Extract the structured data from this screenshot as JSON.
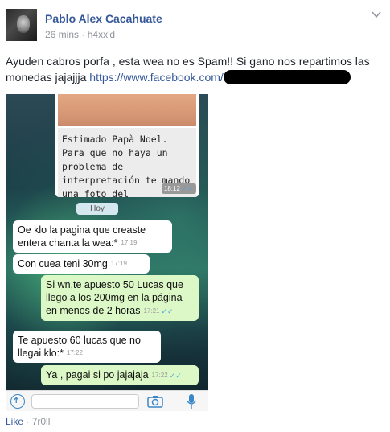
{
  "post": {
    "author": "Pablo Alex Cacahuate",
    "time": "26 mins",
    "location": "h4xx'd",
    "text": "Ayuden cabros porfa , esta wea no es Spam!! Si gano nos repartimos las monedas jajajjja",
    "link": "https://www.facebook.com/",
    "menu_icon": "chevron-down-icon"
  },
  "chat": {
    "photo_note": "Estimado Papà Noel. Para que no haya un problema de interpretación te mando una foto del",
    "photo_time": "18:12",
    "date_label": "Hoy",
    "messages": [
      {
        "dir": "in",
        "text": "Oe klo la pagina que creaste entera chanta la wea:*",
        "time": "17:19"
      },
      {
        "dir": "in",
        "text": "Con cuea teni 30mg",
        "time": "17:19"
      },
      {
        "dir": "out",
        "text": "Si wn,te apuesto 50 Lucas que llego a los 200mg en la página en menos de 2 horas",
        "time": "17:21"
      },
      {
        "dir": "in",
        "text": "Te apuesto 60 lucas que no llegai klo:*",
        "time": "17:22"
      },
      {
        "dir": "out",
        "text": "Ya , pagai si po jajajaja",
        "time": "17:22"
      }
    ]
  },
  "footer": {
    "like": "Like",
    "separator": " · ",
    "extra": "7r0ll"
  },
  "colors": {
    "link": "#365899",
    "meta": "#90949c",
    "out_bubble": "#dcf8c6",
    "in_bubble": "#ffffff"
  }
}
